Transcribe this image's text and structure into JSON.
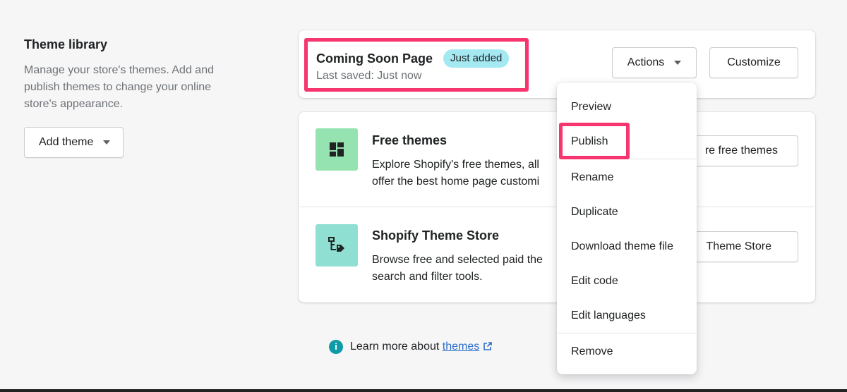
{
  "sidebar": {
    "title": "Theme library",
    "description": "Manage your store's themes. Add and publish themes to change your online store's appearance.",
    "add_theme_label": "Add theme"
  },
  "current_theme": {
    "name": "Coming Soon Page",
    "badge": "Just added",
    "last_saved": "Last saved: Just now",
    "actions_label": "Actions",
    "customize_label": "Customize"
  },
  "theme_sources": [
    {
      "title": "Free themes",
      "description": "Explore Shopify's free themes, all",
      "description_line2": "offer the best home page customi",
      "button_label": "re free themes",
      "icon": "layout-icon"
    },
    {
      "title": "Shopify Theme Store",
      "description": "Browse free and selected paid the",
      "description_line2": "search and filter tools.",
      "button_label": "Theme Store",
      "icon": "shop-tag-icon"
    }
  ],
  "learn_more": {
    "prefix": "Learn more about ",
    "link": "themes"
  },
  "actions_menu": {
    "items": [
      "Preview",
      "Publish",
      "Rename",
      "Duplicate",
      "Download theme file",
      "Edit code",
      "Edit languages",
      "Remove"
    ]
  },
  "colors": {
    "highlight": "#f7366f",
    "badge": "#a4e8f2",
    "free_tile": "#95e3b0",
    "store_tile": "#8fe0d2",
    "link": "#2c6ecb",
    "info": "#0e9aa7"
  }
}
